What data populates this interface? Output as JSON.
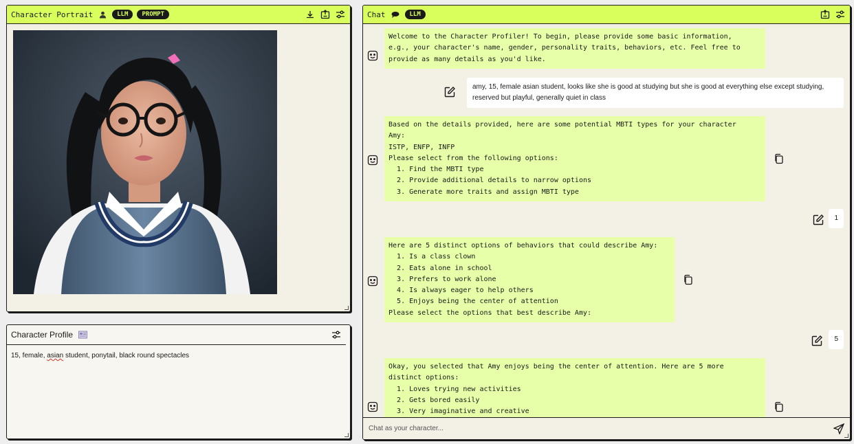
{
  "portrait_panel": {
    "title": "Character Portrait",
    "tag_llm": "LLM",
    "tag_prompt": "PROMPT"
  },
  "profile_panel": {
    "title": "Character Profile",
    "text_before": "15, female, ",
    "text_misspelled": "asian",
    "text_after": " student, ponytail, black round spectacles"
  },
  "chat_panel": {
    "title": "Chat",
    "tag_llm": "LLM",
    "messages": [
      {
        "role": "bot",
        "text": "Welcome to the Character Profiler! To begin, please provide some basic information,\ne.g., your character's name, gender, personality traits, behaviors, etc. Feel free to\nprovide as many details as you'd like."
      },
      {
        "role": "user",
        "text": "amy, 15, female asian student, looks like she is good at studying but she is good at everything else except studying, reserved but playful, generally quiet in class"
      },
      {
        "role": "bot",
        "text": "Based on the details provided, here are some potential MBTI types for your character\nAmy:\nISTP, ENFP, INFP\nPlease select from the following options:\n  1. Find the MBTI type\n  2. Provide additional details to narrow options\n  3. Generate more traits and assign MBTI type"
      },
      {
        "role": "user",
        "text": "1"
      },
      {
        "role": "bot",
        "text": "Here are 5 distinct options of behaviors that could describe Amy:\n  1. Is a class clown\n  2. Eats alone in school\n  3. Prefers to work alone\n  4. Is always eager to help others\n  5. Enjoys being the center of attention\nPlease select the options that best describe Amy:"
      },
      {
        "role": "user",
        "text": "5"
      },
      {
        "role": "bot",
        "text": "Okay, you selected that Amy enjoys being the center of attention. Here are 5 more\ndistinct options:\n  1. Loves trying new activities\n  2. Gets bored easily\n  3. Very imaginative and creative"
      }
    ],
    "input_placeholder": "Chat as your character..."
  }
}
